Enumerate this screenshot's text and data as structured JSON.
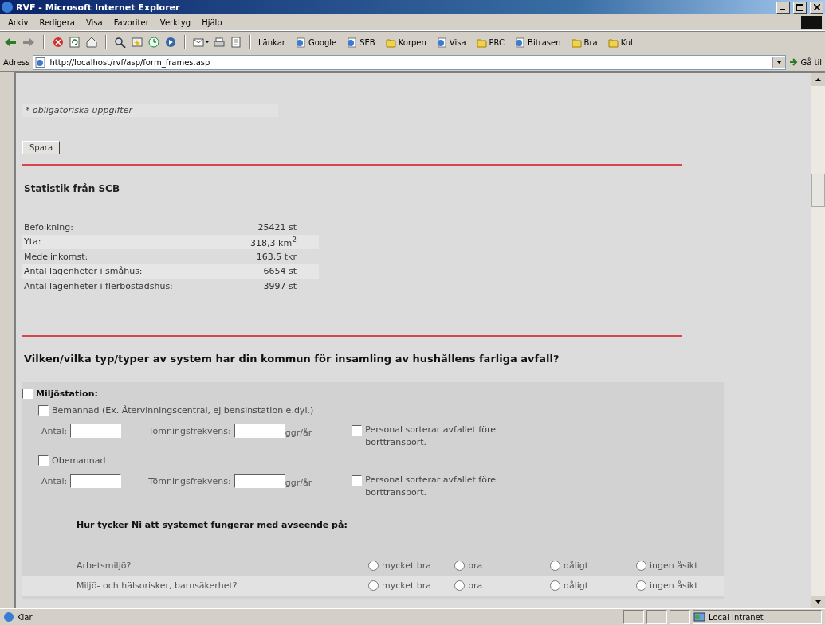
{
  "window": {
    "title": "RVF - Microsoft Internet Explorer"
  },
  "menu_bar": [
    "Arkiv",
    "Redigera",
    "Visa",
    "Favoriter",
    "Verktyg",
    "Hjälp"
  ],
  "links": {
    "label": "Länkar",
    "items": [
      {
        "label": "Google",
        "kind": "page"
      },
      {
        "label": "SEB",
        "kind": "page"
      },
      {
        "label": "Korpen",
        "kind": "folder"
      },
      {
        "label": "Visa",
        "kind": "page"
      },
      {
        "label": "PRC",
        "kind": "folder"
      },
      {
        "label": "Bitrasen",
        "kind": "page"
      },
      {
        "label": "Bra",
        "kind": "folder"
      },
      {
        "label": "Kul",
        "kind": "folder"
      }
    ]
  },
  "address": {
    "label": "Adress",
    "url": "http://localhost/rvf/asp/form_frames.asp",
    "go": "Gå til"
  },
  "page": {
    "required_note": "* obligatoriska uppgifter",
    "save_button": "Spara",
    "stats": {
      "title": "Statistik från SCB",
      "rows": [
        {
          "label": "Befolkning:",
          "value": "25421 st"
        },
        {
          "label": "Yta:",
          "value": "318,3 km$^{2}$"
        },
        {
          "label": "Medelinkomst:",
          "value": "163,5 tkr"
        },
        {
          "label": "Antal lägenheter i småhus:",
          "value": "6654 st"
        },
        {
          "label": "Antal lägenheter i flerbostadshus:",
          "value": "3997 st"
        }
      ]
    },
    "question": "Vilken/vilka typ/typer av system har din kommun för insamling av hushållens farliga avfall?",
    "group": {
      "label": "Miljöstation:",
      "checked": false,
      "options": [
        {
          "label": "Bemannad (Ex. Återvinningscentral, ej bensinstation e.dyl.)",
          "checked": false,
          "count_label": "Antal:",
          "frequency_label": "Tömningsfrekvens:",
          "unit": "ggr/år",
          "staff_sort": {
            "label": "Personal sorterar avfallet före borttransport.",
            "checked": false
          }
        },
        {
          "label": "Obemannad",
          "checked": false,
          "count_label": "Antal:",
          "frequency_label": "Tömningsfrekvens:",
          "unit": "ggr/år",
          "staff_sort": {
            "label": "Personal sorterar avfallet före borttransport.",
            "checked": false
          }
        }
      ],
      "rating": {
        "title": "Hur tycker Ni att systemet fungerar med avseende på:",
        "rows": [
          {
            "label": "Arbetsmiljö?",
            "options": [
              {
                "label": "mycket bra",
                "selected": false
              },
              {
                "label": "bra",
                "selected": false
              },
              {
                "label": "dåligt",
                "selected": false
              },
              {
                "label": "ingen åsikt",
                "selected": false
              }
            ]
          },
          {
            "label": "Miljö- och hälsorisker, barnsäkerhet?",
            "options": [
              {
                "label": "mycket bra",
                "selected": false
              },
              {
                "label": "bra",
                "selected": false
              },
              {
                "label": "dåligt",
                "selected": false
              },
              {
                "label": "ingen åsikt",
                "selected": false
              }
            ]
          }
        ]
      }
    }
  },
  "status_bar": {
    "text": "Klar",
    "zone": "Local intranet"
  }
}
